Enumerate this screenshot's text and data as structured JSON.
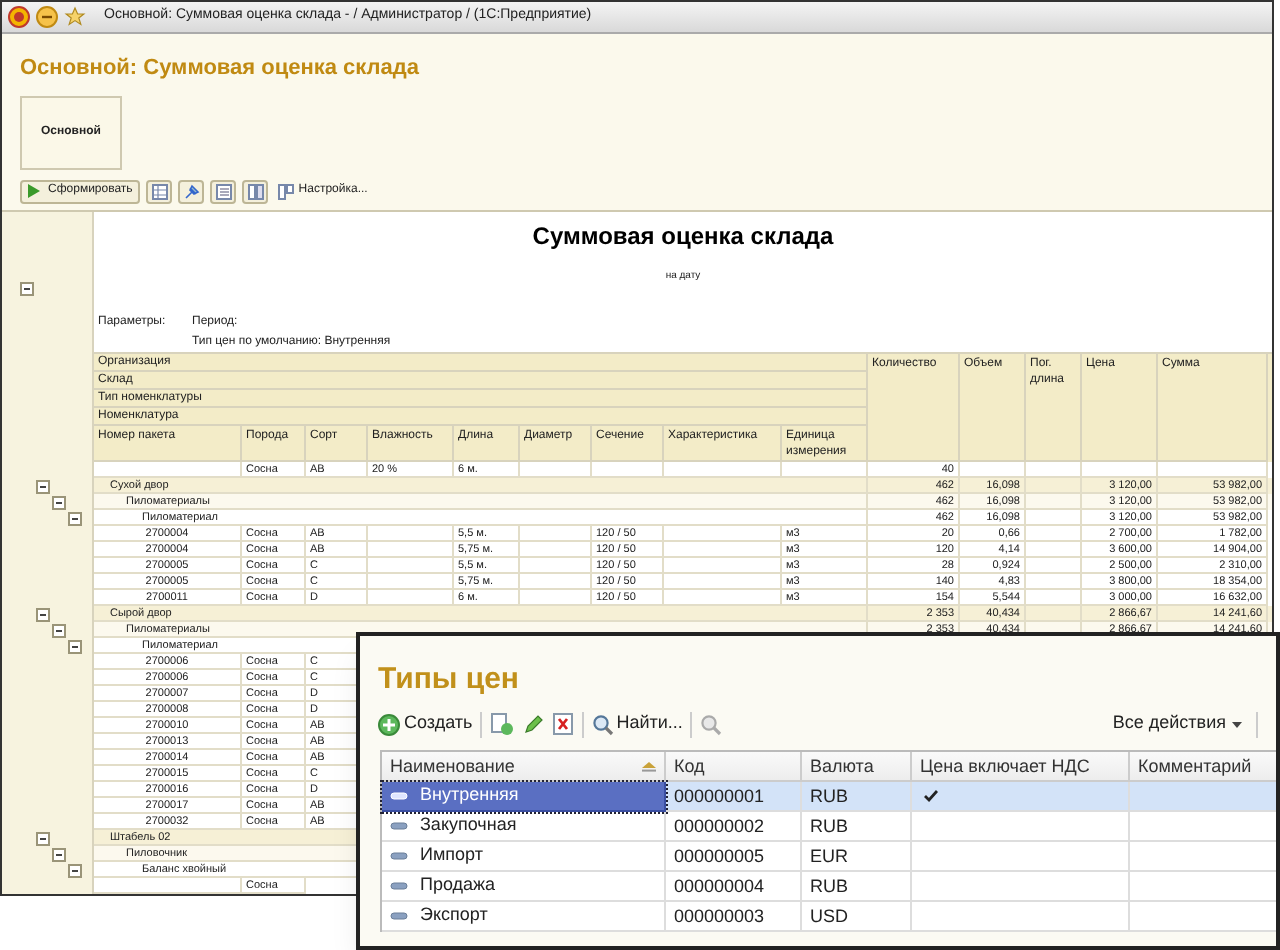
{
  "window": {
    "title": "Основной: Суммовая оценка склада - / Администратор / (1С:Предприятие)"
  },
  "form_title": "Основной: Суммовая оценка склада",
  "panel": {
    "label": "Основной"
  },
  "toolbar": {
    "generate_button": "Сформировать",
    "settings_button": "Настройка..."
  },
  "report": {
    "title": "Суммовая оценка склада",
    "subtitle": "на дату",
    "parameters_label": "Параметры:",
    "parameters": [
      "Период:",
      "Тип цен по умолчанию: Внутренняя"
    ],
    "group_headers": [
      "Организация",
      "Склад",
      "Тип номенклатуры",
      "Номенклатура"
    ],
    "columns": [
      "Номер пакета",
      "Порода",
      "Сорт",
      "Влажность",
      "Длина",
      "Диаметр",
      "Сечение",
      "Характеристика",
      "Единица измерения",
      "Количество",
      "Объем",
      "Пог. длина",
      "Цена",
      "Сумма"
    ],
    "rows": [
      {
        "kind": "item",
        "species": "Сосна",
        "grade": "AB",
        "moisture": "20 %",
        "length": "6 м.",
        "quantity": "40"
      },
      {
        "kind": "group",
        "label": "Сухой двор",
        "quantity": "462",
        "volume": "16,098",
        "price": "3 120,00",
        "sum": "53 982,00",
        "children": [
          {
            "kind": "group",
            "label": "Пиломатериалы",
            "quantity": "462",
            "volume": "16,098",
            "price": "3 120,00",
            "sum": "53 982,00",
            "children": [
              {
                "kind": "group",
                "label": "Пиломатериал",
                "quantity": "462",
                "volume": "16,098",
                "price": "3 120,00",
                "sum": "53 982,00",
                "children": [
                  {
                    "kind": "item",
                    "package": "2700004",
                    "species": "Сосна",
                    "grade": "AB",
                    "length": "5,5 м.",
                    "section": "120 / 50",
                    "unit": "м3",
                    "quantity": "20",
                    "volume": "0,66",
                    "price": "2 700,00",
                    "sum": "1 782,00"
                  },
                  {
                    "kind": "item",
                    "package": "2700004",
                    "species": "Сосна",
                    "grade": "AB",
                    "length": "5,75 м.",
                    "section": "120 / 50",
                    "unit": "м3",
                    "quantity": "120",
                    "volume": "4,14",
                    "price": "3 600,00",
                    "sum": "14 904,00"
                  },
                  {
                    "kind": "item",
                    "package": "2700005",
                    "species": "Сосна",
                    "grade": "C",
                    "length": "5,5 м.",
                    "section": "120 / 50",
                    "unit": "м3",
                    "quantity": "28",
                    "volume": "0,924",
                    "price": "2 500,00",
                    "sum": "2 310,00"
                  },
                  {
                    "kind": "item",
                    "package": "2700005",
                    "species": "Сосна",
                    "grade": "C",
                    "length": "5,75 м.",
                    "section": "120 / 50",
                    "unit": "м3",
                    "quantity": "140",
                    "volume": "4,83",
                    "price": "3 800,00",
                    "sum": "18 354,00"
                  },
                  {
                    "kind": "item",
                    "package": "2700011",
                    "species": "Сосна",
                    "grade": "D",
                    "length": "6 м.",
                    "section": "120 / 50",
                    "unit": "м3",
                    "quantity": "154",
                    "volume": "5,544",
                    "price": "3 000,00",
                    "sum": "16 632,00"
                  }
                ]
              }
            ]
          }
        ]
      },
      {
        "kind": "group",
        "label": "Сырой двор",
        "quantity": "2 353",
        "volume": "40,434",
        "price": "2 866,67",
        "sum": "14 241,60",
        "children": [
          {
            "kind": "group",
            "label": "Пиломатериалы",
            "quantity": "2 353",
            "volume": "40,434",
            "price": "2 866,67",
            "sum": "14 241,60",
            "children": [
              {
                "kind": "group",
                "label": "Пиломатериал",
                "children": [
                  {
                    "kind": "item",
                    "package": "2700006",
                    "species": "Сосна",
                    "grade": "C"
                  },
                  {
                    "kind": "item",
                    "package": "2700006",
                    "species": "Сосна",
                    "grade": "C"
                  },
                  {
                    "kind": "item",
                    "package": "2700007",
                    "species": "Сосна",
                    "grade": "D"
                  },
                  {
                    "kind": "item",
                    "package": "2700008",
                    "species": "Сосна",
                    "grade": "D"
                  },
                  {
                    "kind": "item",
                    "package": "2700010",
                    "species": "Сосна",
                    "grade": "AB"
                  },
                  {
                    "kind": "item",
                    "package": "2700013",
                    "species": "Сосна",
                    "grade": "AB"
                  },
                  {
                    "kind": "item",
                    "package": "2700014",
                    "species": "Сосна",
                    "grade": "AB"
                  },
                  {
                    "kind": "item",
                    "package": "2700015",
                    "species": "Сосна",
                    "grade": "C"
                  },
                  {
                    "kind": "item",
                    "package": "2700016",
                    "species": "Сосна",
                    "grade": "D"
                  },
                  {
                    "kind": "item",
                    "package": "2700017",
                    "species": "Сосна",
                    "grade": "AB"
                  },
                  {
                    "kind": "item",
                    "package": "2700032",
                    "species": "Сосна",
                    "grade": "AB"
                  }
                ]
              }
            ]
          }
        ]
      },
      {
        "kind": "group",
        "label": "Штабель 02",
        "children": [
          {
            "kind": "group",
            "label": "Пиловочник",
            "children": [
              {
                "kind": "group",
                "label": "Баланс хвойный",
                "children": [
                  {
                    "kind": "item",
                    "species": "Сосна"
                  }
                ]
              }
            ]
          }
        ]
      }
    ]
  },
  "price_types": {
    "title": "Типы цен",
    "toolbar": {
      "create_button": "Создать",
      "find_button": "Найти...",
      "all_actions": "Все действия"
    },
    "columns": [
      "Наименование",
      "Код",
      "Валюта",
      "Цена включает НДС",
      "Комментарий"
    ],
    "rows": [
      {
        "name": "Внутренняя",
        "code": "000000001",
        "currency": "RUB",
        "vat_included": true,
        "selected": true
      },
      {
        "name": "Закупочная",
        "code": "000000002",
        "currency": "RUB",
        "vat_included": false,
        "selected": false
      },
      {
        "name": "Импорт",
        "code": "000000005",
        "currency": "EUR",
        "vat_included": false,
        "selected": false
      },
      {
        "name": "Продажа",
        "code": "000000004",
        "currency": "RUB",
        "vat_included": false,
        "selected": false
      },
      {
        "name": "Экспорт",
        "code": "000000003",
        "currency": "USD",
        "vat_included": false,
        "selected": false
      }
    ]
  }
}
